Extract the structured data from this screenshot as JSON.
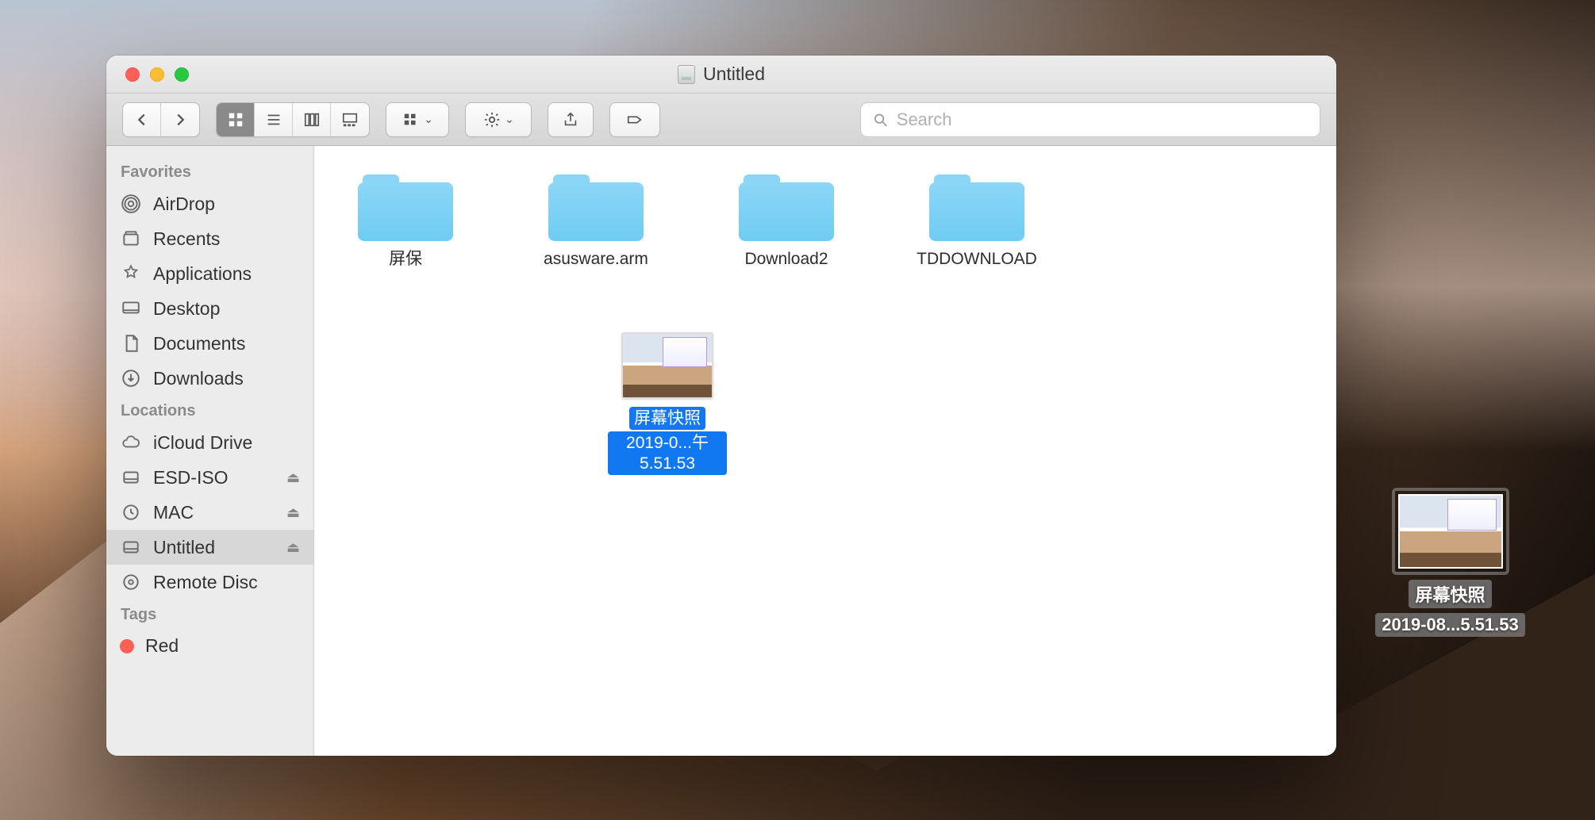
{
  "window": {
    "title": "Untitled"
  },
  "toolbar": {
    "search_placeholder": "Search"
  },
  "sidebar": {
    "sections": {
      "favorites": {
        "header": "Favorites",
        "items": [
          {
            "icon": "airdrop",
            "label": "AirDrop"
          },
          {
            "icon": "recents",
            "label": "Recents"
          },
          {
            "icon": "applications",
            "label": "Applications"
          },
          {
            "icon": "desktop",
            "label": "Desktop"
          },
          {
            "icon": "documents",
            "label": "Documents"
          },
          {
            "icon": "downloads",
            "label": "Downloads"
          }
        ]
      },
      "locations": {
        "header": "Locations",
        "items": [
          {
            "icon": "icloud",
            "label": "iCloud Drive",
            "eject": false
          },
          {
            "icon": "disk",
            "label": "ESD-ISO",
            "eject": true
          },
          {
            "icon": "timemachine",
            "label": "MAC",
            "eject": true
          },
          {
            "icon": "disk",
            "label": "Untitled",
            "eject": true,
            "active": true
          },
          {
            "icon": "optical",
            "label": "Remote Disc",
            "eject": false
          }
        ]
      },
      "tags": {
        "header": "Tags",
        "items": [
          {
            "color": "red",
            "label": "Red"
          }
        ]
      }
    }
  },
  "content": {
    "folders": [
      {
        "label": "屏保"
      },
      {
        "label": "asusware.arm"
      },
      {
        "label": "Download2"
      },
      {
        "label": "TDDOWNLOAD"
      }
    ],
    "selected_file": {
      "line1": "屏幕快照",
      "line2": "2019-0...午5.51.53"
    }
  },
  "desktop_file": {
    "line1": "屏幕快照",
    "line2": "2019-08...5.51.53"
  }
}
